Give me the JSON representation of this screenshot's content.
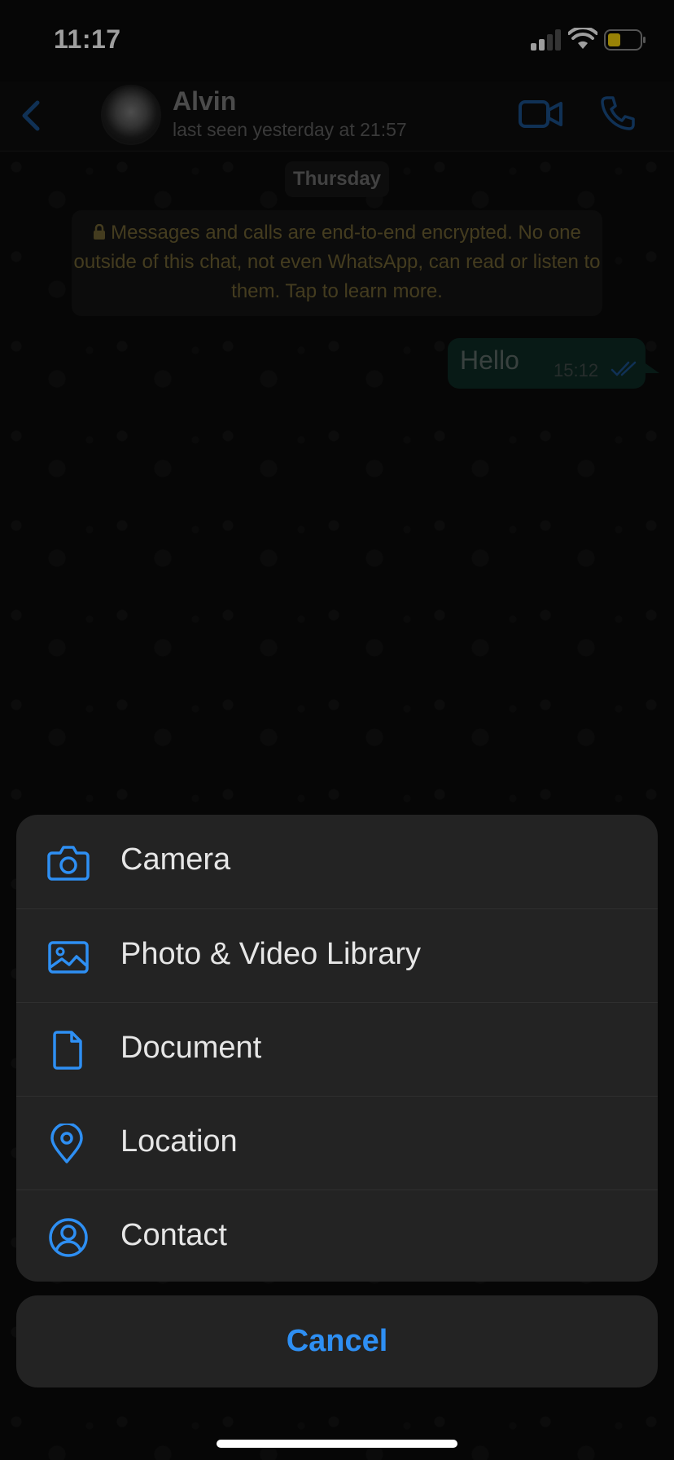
{
  "status_bar": {
    "time": "11:17"
  },
  "chat_header": {
    "contact_name": "Alvin",
    "contact_status": "last seen yesterday at 21:57"
  },
  "chat": {
    "day_label": "Thursday",
    "encryption_notice": "Messages and calls are end-to-end encrypted. No one outside of this chat, not even WhatsApp, can read or listen to them. Tap to learn more.",
    "messages": [
      {
        "text": "Hello",
        "time": "15:12",
        "status": "read"
      }
    ]
  },
  "action_sheet": {
    "items": [
      {
        "label": "Camera",
        "icon": "camera-icon"
      },
      {
        "label": "Photo & Video Library",
        "icon": "photo-icon"
      },
      {
        "label": "Document",
        "icon": "document-icon"
      },
      {
        "label": "Location",
        "icon": "location-pin-icon"
      },
      {
        "label": "Contact",
        "icon": "contact-icon"
      }
    ],
    "cancel_label": "Cancel"
  },
  "colors": {
    "accent": "#2e8ff3",
    "sheet_background": "#232323",
    "battery_fill": "#f5d20a"
  }
}
